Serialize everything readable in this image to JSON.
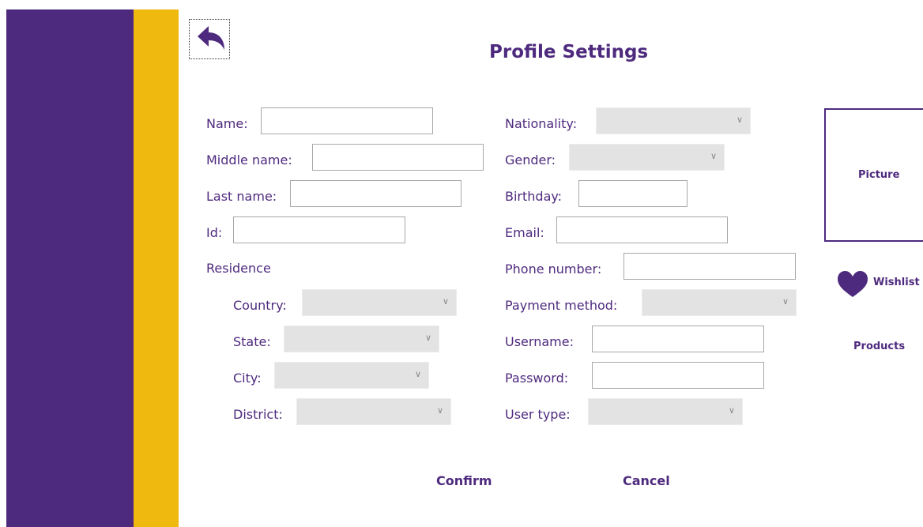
{
  "header": {
    "title": "Profile Settings",
    "back_icon": "back-arrow-icon"
  },
  "personal": {
    "name_label": "Name:",
    "middle_name_label": "Middle name:",
    "last_name_label": "Last name:",
    "id_label": "Id:",
    "residence_label": "Residence",
    "country_label": "Country:",
    "state_label": "State:",
    "city_label": "City:",
    "district_label": "District:"
  },
  "account": {
    "nationality_label": "Nationality:",
    "gender_label": "Gender:",
    "birthday_label": "Birthday:",
    "email_label": "Email:",
    "phone_label": "Phone number:",
    "payment_label": "Payment method:",
    "username_label": "Username:",
    "password_label": "Password:",
    "user_type_label": "User type:"
  },
  "side": {
    "picture_label": "Picture",
    "wishlist_label": "Wishlist",
    "products_label": "Products",
    "wishlist_icon": "heart-icon"
  },
  "actions": {
    "confirm_label": "Confirm",
    "cancel_label": "Cancel"
  },
  "colors": {
    "primary": "#4e2a7e",
    "accent": "#efb90f",
    "dropdown_bg": "#e3e3e3"
  }
}
